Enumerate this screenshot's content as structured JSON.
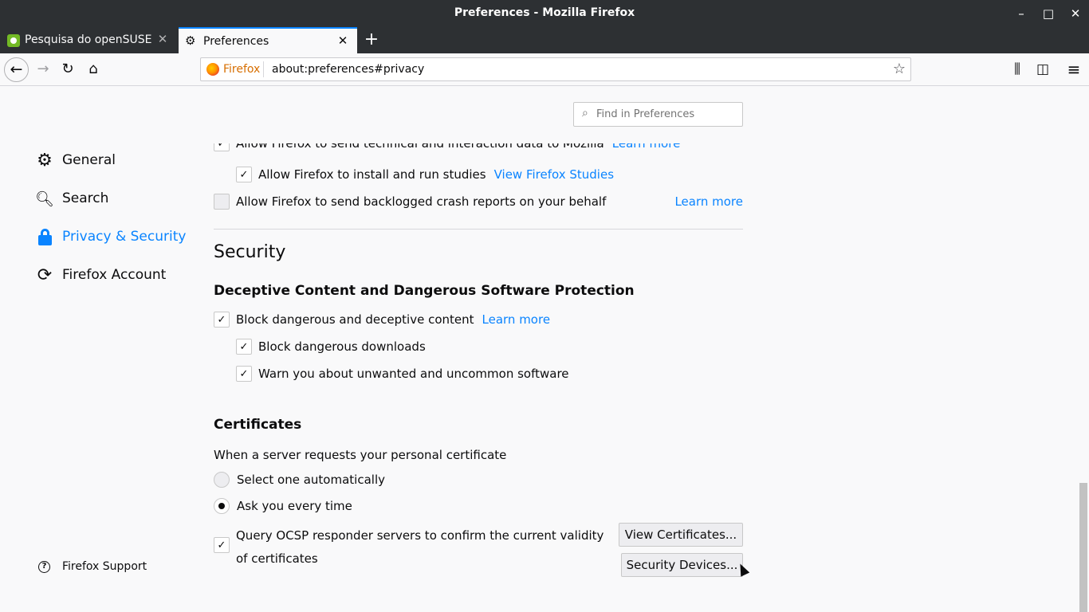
{
  "window": {
    "title": "Preferences - Mozilla Firefox",
    "minimize_glyph": "–",
    "maximize_glyph": "□",
    "close_glyph": "✕"
  },
  "tabs": [
    {
      "label": "Pesquisa do openSUSE",
      "icon": "opensuse-favicon",
      "active": false
    },
    {
      "label": "Preferences",
      "icon": "gear-icon",
      "active": true
    }
  ],
  "tab_close_glyph": "✕",
  "new_tab_glyph": "+",
  "nav": {
    "back_glyph": "←",
    "forward_glyph": "→",
    "reload_glyph": "↻",
    "home_glyph": "⌂",
    "identity_label": "Firefox",
    "url": "about:preferences#privacy",
    "bookmark_glyph": "☆",
    "library_glyph": "⫼",
    "sidebar_glyph": "◫",
    "menu_glyph": "≡"
  },
  "find": {
    "placeholder": "Find in Preferences",
    "icon_glyph": "⌕"
  },
  "sidebar": {
    "items": [
      {
        "label": "General",
        "icon": "gear-icon",
        "glyph": "⚙"
      },
      {
        "label": "Search",
        "icon": "search-icon",
        "glyph": "🔍︎"
      },
      {
        "label": "Privacy & Security",
        "icon": "lock-icon",
        "selected": true
      },
      {
        "label": "Firefox Account",
        "icon": "sync-icon",
        "glyph": "⟳"
      }
    ],
    "support_label": "Firefox Support",
    "support_glyph": "?"
  },
  "data_collection": {
    "partial_row": {
      "label": "Allow Firefox to send technical and interaction data to Mozilla",
      "link": "Learn more",
      "checked": true
    },
    "studies": {
      "label": "Allow Firefox to install and run studies",
      "link": "View Firefox Studies",
      "checked": true
    },
    "crash_reports": {
      "label": "Allow Firefox to send backlogged crash reports on your behalf",
      "link": "Learn more",
      "checked": false
    }
  },
  "check_glyph": "✓",
  "security": {
    "heading": "Security",
    "deceptive": {
      "heading": "Deceptive Content and Dangerous Software Protection",
      "block_content": {
        "label": "Block dangerous and deceptive content",
        "link": "Learn more",
        "checked": true
      },
      "block_downloads": {
        "label": "Block dangerous downloads",
        "checked": true
      },
      "warn_software": {
        "label": "Warn you about unwanted and uncommon software",
        "checked": true
      }
    },
    "certificates": {
      "heading": "Certificates",
      "description": "When a server requests your personal certificate",
      "option_auto": {
        "label": "Select one automatically",
        "selected": false
      },
      "option_ask": {
        "label": "Ask you every time",
        "selected": true
      },
      "ocsp": {
        "label": "Query OCSP responder servers to confirm the current validity of certificates",
        "checked": true
      },
      "view_certificates_button": "View Certificates...",
      "security_devices_button": "Security Devices..."
    }
  }
}
